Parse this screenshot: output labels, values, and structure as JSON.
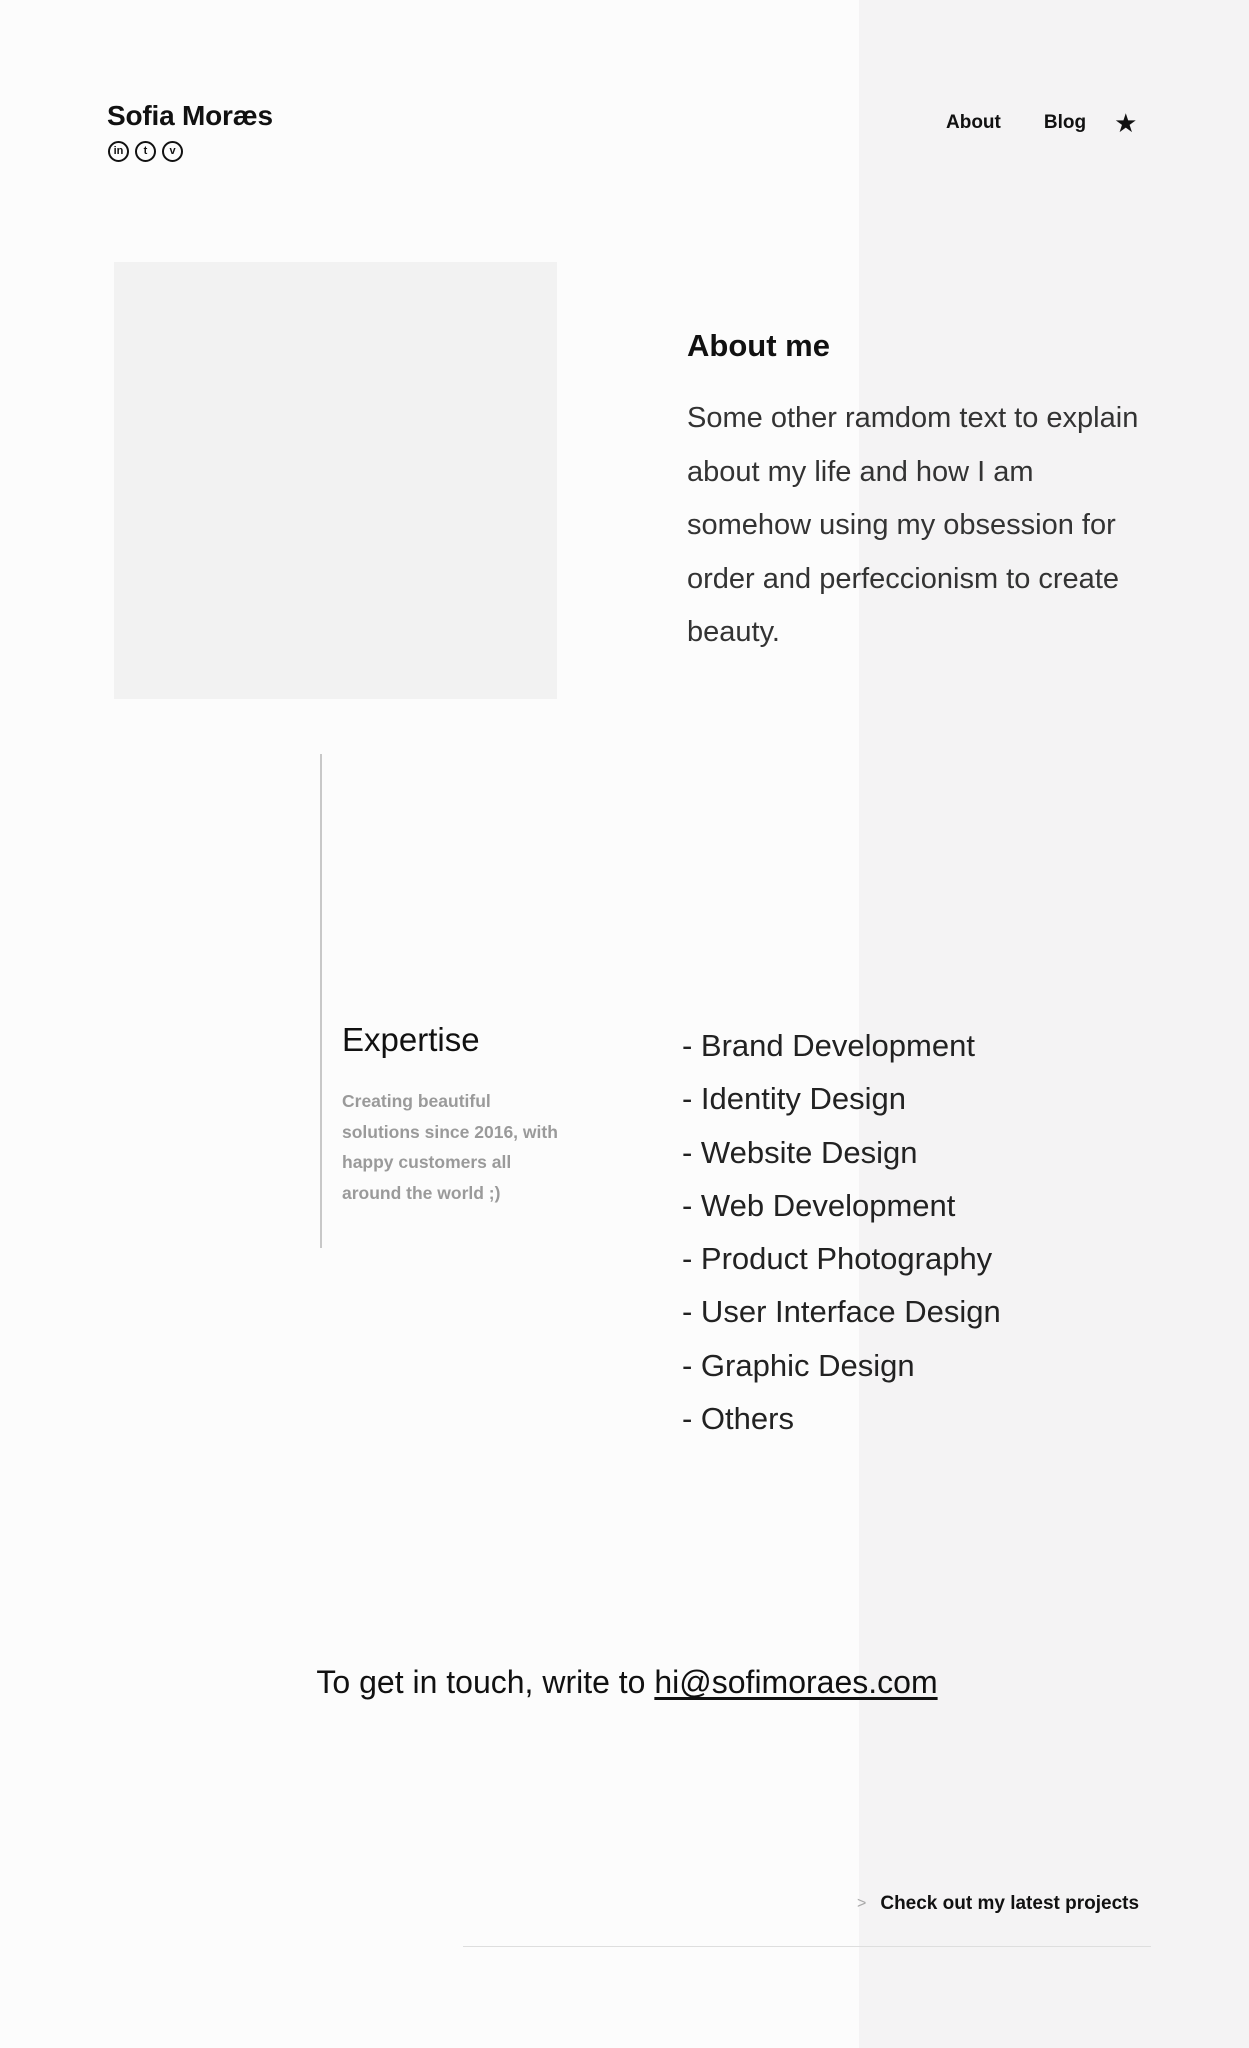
{
  "header": {
    "brand_name": "Sofia Moræs",
    "socials": [
      {
        "icon": "linkedin-icon",
        "glyph": "in"
      },
      {
        "icon": "tumblr-icon",
        "glyph": "t"
      },
      {
        "icon": "vimeo-icon",
        "glyph": "v"
      }
    ],
    "nav": {
      "about_label": "About",
      "blog_label": "Blog",
      "star_icon": "star-icon",
      "star_glyph": "★"
    }
  },
  "about": {
    "title": "About me",
    "text": "Some other ramdom text to explain about my life and how I am somehow using my obses­sion for order and perfeccionism to create beauty."
  },
  "expertise": {
    "title": "Expertise",
    "description": "Creating beautiful solutions since 2016, with happy customers all around the world ;)",
    "items": [
      "- Brand Development",
      "- Identity Design",
      "- Website Design",
      "- Web Development",
      "- Product Photography",
      "- User Interface Design",
      "- Graphic Design",
      "- Others"
    ]
  },
  "contact": {
    "prefix": "To get in touch, write to ",
    "email": "hi@sofimoraes.com"
  },
  "footer": {
    "arrow_glyph": ">",
    "projects_label": "Check out my latest projects"
  },
  "colors": {
    "background": "#fcfcfc",
    "right_panel": "#f4f3f4",
    "photo_placeholder": "#f2f2f2",
    "muted_text": "#9a9a9a"
  }
}
